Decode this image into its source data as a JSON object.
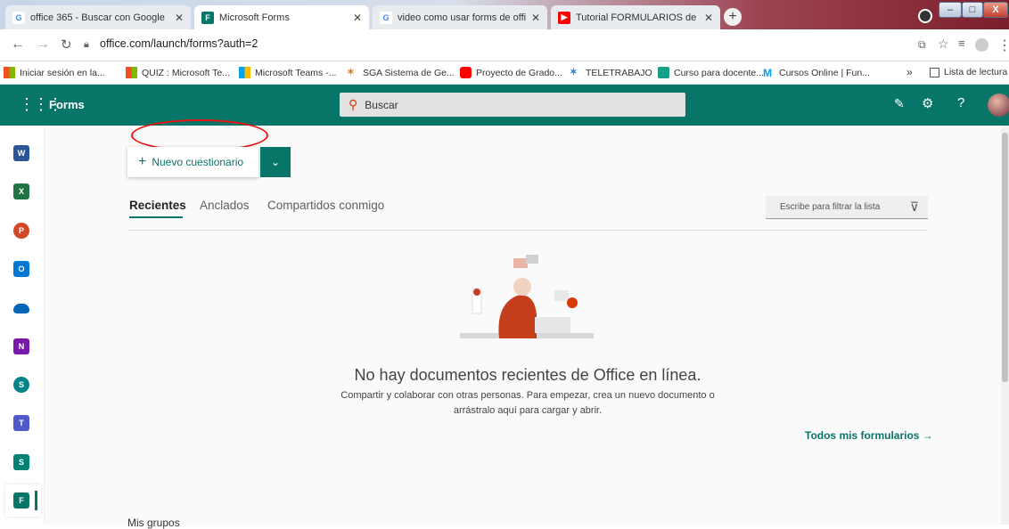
{
  "browser": {
    "tabs": [
      {
        "title": "office 365 - Buscar con Google",
        "icon": "google-icon"
      },
      {
        "title": "Microsoft Forms",
        "icon": "forms-icon",
        "active": true
      },
      {
        "title": "video como usar forms de office",
        "icon": "google-icon"
      },
      {
        "title": "Tutorial FORMULARIOS de Mi",
        "icon": "youtube-icon"
      }
    ],
    "new_tab": "+",
    "window_controls": {
      "minimize": "–",
      "maximize": "□",
      "close": "X"
    },
    "url": "office.com/launch/forms?auth=2",
    "bookmarks": [
      {
        "label": "Iniciar sesión en la...",
        "icon": "microsoft-icon"
      },
      {
        "label": "QUIZ : Microsoft Te...",
        "icon": "microsoft-icon"
      },
      {
        "label": "Microsoft Teams -...",
        "icon": "microsoft-icon"
      },
      {
        "label": "SGA Sistema de Ge...",
        "icon": "sga-icon"
      },
      {
        "label": "Proyecto de Grado...",
        "icon": "youtube-icon"
      },
      {
        "label": "TELETRABAJO",
        "icon": "sga-icon"
      },
      {
        "label": "Curso para docente...",
        "icon": "course-icon"
      },
      {
        "label": "Cursos Online | Fun...",
        "icon": "movistar-icon"
      }
    ],
    "more_bookmarks": "»",
    "reading_list": "Lista de lectura"
  },
  "app": {
    "name": "Forms",
    "search_placeholder": "Buscar",
    "accent": "#077568"
  },
  "main": {
    "new_quiz_label": "Nuevo cuestionario",
    "tabs": [
      "Recientes",
      "Anclados",
      "Compartidos conmigo"
    ],
    "filter_placeholder": "Escribe para filtrar la lista",
    "empty_title": "No hay documentos recientes de Office en línea.",
    "empty_sub_1": "Compartir y colaborar con otras personas. Para empezar, crea un nuevo documento o",
    "empty_sub_2": "arrástralo aquí para cargar y abrir.",
    "all_forms_link": "Todos mis formularios →",
    "my_groups": "Mis grupos"
  },
  "rail": [
    {
      "name": "word-icon",
      "letter": "W",
      "color": "#2b579a"
    },
    {
      "name": "excel-icon",
      "letter": "X",
      "color": "#217346"
    },
    {
      "name": "powerpoint-icon",
      "letter": "P",
      "color": "#d24726"
    },
    {
      "name": "outlook-icon",
      "letter": "O",
      "color": "#0078d4"
    },
    {
      "name": "onedrive-icon",
      "letter": "",
      "color": "#0364b8"
    },
    {
      "name": "onenote-icon",
      "letter": "N",
      "color": "#7719aa"
    },
    {
      "name": "sharepoint-icon",
      "letter": "S",
      "color": "#038387"
    },
    {
      "name": "teams-icon",
      "letter": "T",
      "color": "#5059c9"
    },
    {
      "name": "sway-icon",
      "letter": "S",
      "color": "#008272"
    },
    {
      "name": "forms-icon",
      "letter": "F",
      "color": "#077568"
    }
  ]
}
